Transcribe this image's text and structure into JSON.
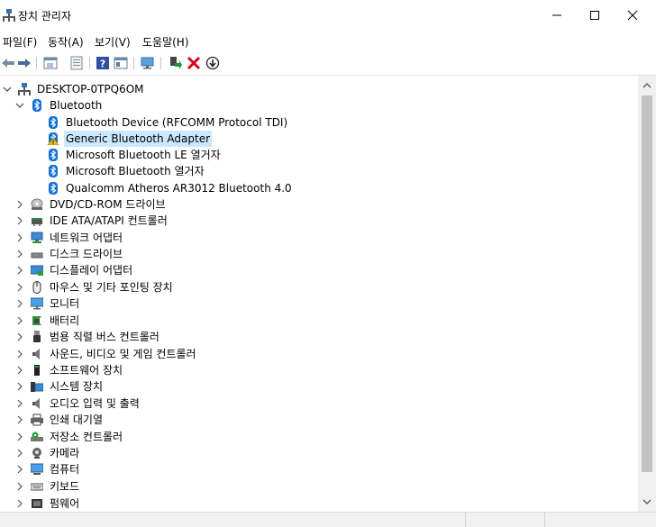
{
  "window": {
    "title": "장치 관리자"
  },
  "menu": [
    "파일(F)",
    "동작(A)",
    "보기(V)",
    "도움말(H)"
  ],
  "toolbar": [
    "back-icon",
    "forward-icon",
    "properties-icon",
    "list-icon",
    "help-icon",
    "view-icon",
    "scan-monitor-icon",
    "enable-device-icon",
    "uninstall-icon",
    "update-driver-icon"
  ],
  "tree": {
    "root": "DESKTOP-0TPQ6OM",
    "bluetooth": {
      "label": "Bluetooth",
      "children": [
        "Bluetooth Device (RFCOMM Protocol TDI)",
        "Generic Bluetooth Adapter",
        "Microsoft Bluetooth LE 열거자",
        "Microsoft Bluetooth 열거자",
        "Qualcomm Atheros AR3012 Bluetooth 4.0"
      ],
      "selected_index": 1
    },
    "categories": [
      {
        "label": "DVD/CD-ROM 드라이브",
        "icon": "dvd-icon"
      },
      {
        "label": "IDE ATA/ATAPI 컨트롤러",
        "icon": "ide-controller-icon"
      },
      {
        "label": "네트워크 어댑터",
        "icon": "network-adapter-icon"
      },
      {
        "label": "디스크 드라이브",
        "icon": "disk-drive-icon"
      },
      {
        "label": "디스플레이 어댑터",
        "icon": "display-adapter-icon"
      },
      {
        "label": "마우스 및 기타 포인팅 장치",
        "icon": "mouse-icon"
      },
      {
        "label": "모니터",
        "icon": "monitor-icon"
      },
      {
        "label": "배터리",
        "icon": "battery-icon"
      },
      {
        "label": "범용 직렬 버스 컨트롤러",
        "icon": "usb-icon"
      },
      {
        "label": "사운드, 비디오 및 게임 컨트롤러",
        "icon": "sound-icon"
      },
      {
        "label": "소프트웨어 장치",
        "icon": "software-device-icon"
      },
      {
        "label": "시스템 장치",
        "icon": "system-device-icon"
      },
      {
        "label": "오디오 입력 및 출력",
        "icon": "audio-io-icon"
      },
      {
        "label": "인쇄 대기열",
        "icon": "printer-icon"
      },
      {
        "label": "저장소 컨트롤러",
        "icon": "storage-controller-icon"
      },
      {
        "label": "카메라",
        "icon": "camera-icon"
      },
      {
        "label": "컴퓨터",
        "icon": "computer-icon"
      },
      {
        "label": "키보드",
        "icon": "keyboard-icon"
      },
      {
        "label": "펌웨어",
        "icon": "firmware-icon"
      }
    ]
  },
  "colors": {
    "selection": "#cce8ff",
    "bluetooth": "#1170d8",
    "uninstall": "#d9001b",
    "enable": "#1e9a2e"
  }
}
